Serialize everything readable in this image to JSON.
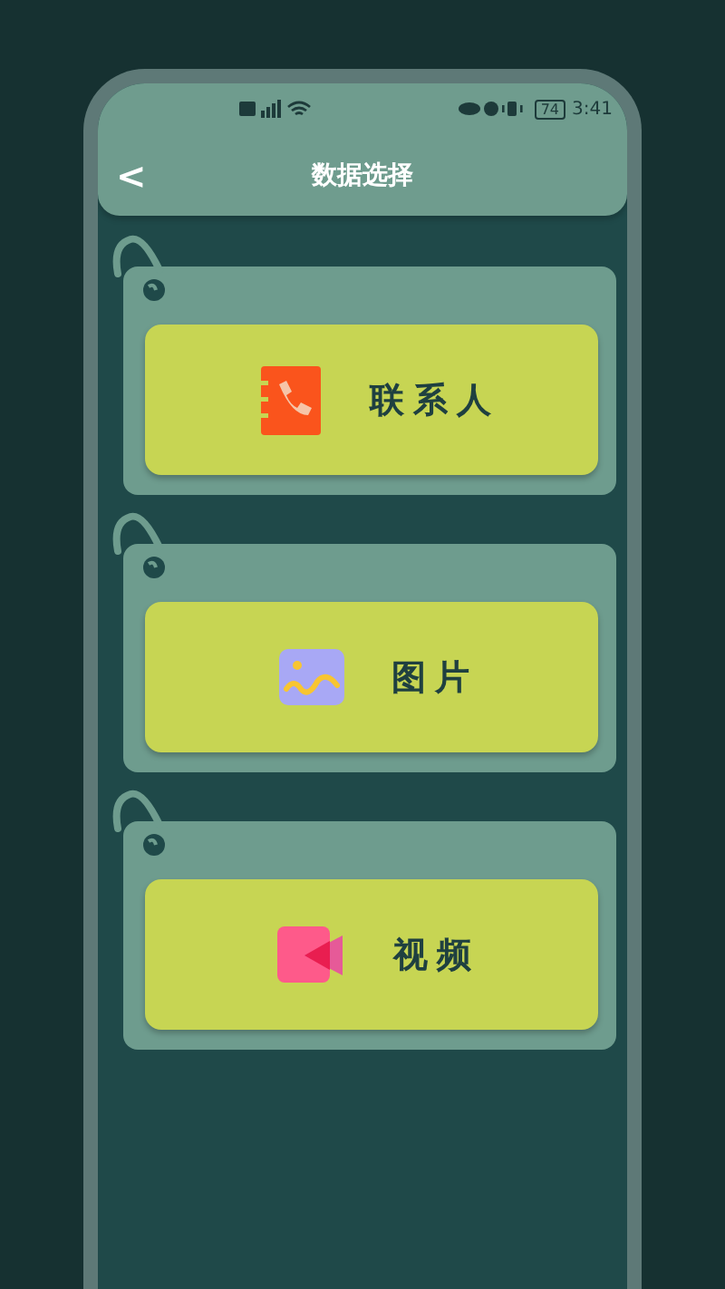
{
  "status_bar": {
    "battery": "74",
    "time": "3:41"
  },
  "header": {
    "back": "<",
    "title": "数据选择"
  },
  "items": [
    {
      "kind": "contacts",
      "label": "联系人"
    },
    {
      "kind": "picture",
      "label": "图片"
    },
    {
      "kind": "video",
      "label": "视频"
    }
  ]
}
